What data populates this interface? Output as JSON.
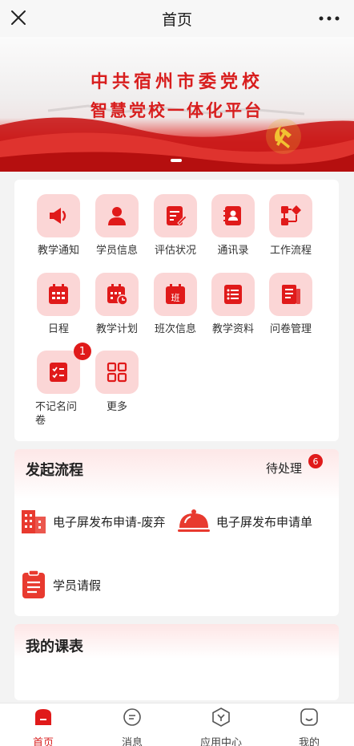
{
  "header": {
    "title": "首页",
    "close_icon": "close-icon",
    "more_icon": "more-icon"
  },
  "banner": {
    "line1": "中共宿州市委党校",
    "line2": "智慧党校一体化平台"
  },
  "grid": {
    "items": [
      {
        "label": "教学通知",
        "icon": "megaphone-icon"
      },
      {
        "label": "学员信息",
        "icon": "user-icon"
      },
      {
        "label": "评估状况",
        "icon": "edit-document-icon"
      },
      {
        "label": "通讯录",
        "icon": "contacts-icon"
      },
      {
        "label": "工作流程",
        "icon": "workflow-icon"
      },
      {
        "label": "日程",
        "icon": "calendar-icon"
      },
      {
        "label": "教学计划",
        "icon": "calendar-clock-icon"
      },
      {
        "label": "班次信息",
        "icon": "class-calendar-icon",
        "glyph": "班"
      },
      {
        "label": "教学资料",
        "icon": "list-document-icon"
      },
      {
        "label": "问卷管理",
        "icon": "questionnaire-icon"
      },
      {
        "label": "不记名问\n卷",
        "icon": "checklist-icon",
        "badge": "1"
      },
      {
        "label": "更多",
        "icon": "grid-more-icon"
      }
    ]
  },
  "flow": {
    "title": "发起流程",
    "pending_label": "待处理",
    "pending_count": "6",
    "items": [
      {
        "label": "电子屏发布申请-废弃",
        "icon": "building-icon"
      },
      {
        "label": "电子屏发布申请单",
        "icon": "dish-cover-icon"
      },
      {
        "label": "学员请假",
        "icon": "clipboard-icon"
      }
    ]
  },
  "course": {
    "title": "我的课表"
  },
  "tabbar": {
    "tabs": [
      {
        "label": "首页",
        "icon": "home-icon",
        "active": true
      },
      {
        "label": "消息",
        "icon": "message-icon"
      },
      {
        "label": "应用中心",
        "icon": "app-center-icon"
      },
      {
        "label": "我的",
        "icon": "profile-icon"
      }
    ]
  },
  "colors": {
    "accent": "#d81e1e",
    "tile_bg": "#fbd6d6"
  }
}
